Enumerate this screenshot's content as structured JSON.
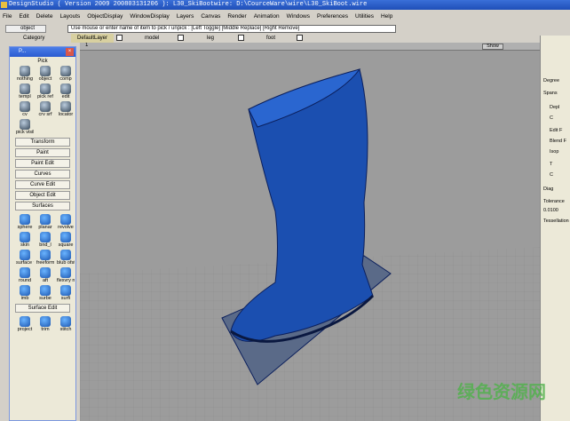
{
  "title": "DesignStudio ( Version 2009  200803131206 ): L30_SkiBootwire: D:\\CourceWare\\wire\\L30_SkiBoot.wire",
  "menu": [
    "File",
    "Edit",
    "Delete",
    "Layouts",
    "ObjectDisplay",
    "WindowDisplay",
    "Layers",
    "Canvas",
    "Render",
    "Animation",
    "Windows",
    "Preferences",
    "Utilities",
    "Help"
  ],
  "pick_mode": "object",
  "prompt": "Use mouse or enter name of item to pick / unpick : [Left Toggle] [Middle Replace] [Right Remove]",
  "layers": {
    "category": "Category",
    "items": [
      "DefaultLayer",
      "model",
      "leg",
      "foot"
    ]
  },
  "viewport": {
    "label": "1",
    "show_label": "Show"
  },
  "palette": {
    "title": "P...",
    "pick_label": "Pick",
    "pick_tools": [
      "nothing",
      "object",
      "comp",
      "templ",
      "pick ref",
      "edit",
      "cv",
      "crv srf",
      "locator",
      "pick visibl"
    ],
    "sections": [
      "Transform",
      "Paint",
      "Paint Edit",
      "Curves",
      "Curve Edit",
      "Object Edit"
    ],
    "surfaces_label": "Surfaces",
    "surface_tools": [
      "sphere",
      "planar",
      "revolve",
      "skin",
      "bnd_l",
      "square",
      "surface fillet",
      "freeform blend",
      "blub ofst",
      "round",
      "aft",
      "flexvry net",
      "imb",
      "surbe",
      "surfi"
    ],
    "surface_edit_label": "Surface Edit",
    "surface_edit_tools": [
      "project",
      "trim",
      "stitch"
    ]
  },
  "right_panel": {
    "items": [
      "Degree",
      "Spans",
      "Depl",
      "C",
      "Edit F",
      "Blend F",
      "Isop",
      "T",
      "C",
      "Diag",
      "Tolerance",
      "0.0100",
      "Tessellation"
    ]
  },
  "watermark": "绿色资源网"
}
